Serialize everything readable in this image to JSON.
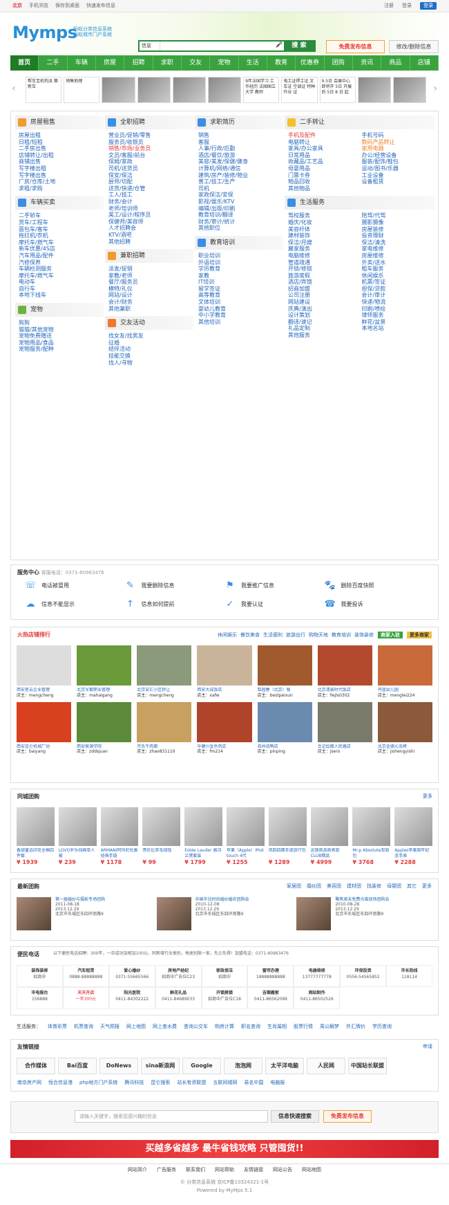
{
  "topbar": {
    "city": "北京",
    "links": [
      "手机浏览",
      "保存到桌面",
      "快速发布信息"
    ],
    "register": "注册",
    "login": "登录",
    "login2": "登录"
  },
  "header": {
    "logo": "Mymps",
    "slogan1": "蚂蚁分类信息系统",
    "slogan2": "蚂蚁城市门户系统",
    "search_select": "信息",
    "search_placeholder": "请输入关键字",
    "search_btn": "搜 索",
    "post_btn": "免费发布信息",
    "edit_btn": "修改/删除信息"
  },
  "nav": [
    "首页",
    "二手",
    "车辆",
    "房屋",
    "招聘",
    "求职",
    "交友",
    "宠物",
    "生活",
    "教育",
    "优惠券",
    "团购",
    "资讯",
    "商品",
    "店铺"
  ],
  "slider": [
    "帮车宝机构派 赛新车",
    "销售助理",
    "9年法国学习 工作经历 法国国立大学 教师",
    "电工证焊工证 叉车证 空调证 特种作业 证",
    "9.5日 会展中心即将开 5日 开展后 5日 8 日 起"
  ],
  "cats": {
    "house": {
      "title": "房屋租售",
      "items": [
        "房屋出租",
        "日租/短租",
        "二手房出售",
        "店铺转让/出租",
        "商铺出售",
        "写字楼出租",
        "写字楼出售",
        "厂房/仓库/土地",
        "求租/求购"
      ]
    },
    "car": {
      "title": "车辆买卖",
      "items": [
        "二手轿车",
        "货车/工程车",
        "面包车/客车",
        "拖拉机/农机",
        "摩托车/燃气车",
        "新车优惠/4S店",
        "汽车用品/配件",
        "汽修保养",
        "车辆检测服务",
        "摩托车/燃气车",
        "电动车",
        "自行车",
        "本地下线车"
      ]
    },
    "pet": {
      "title": "宠物",
      "items": [
        "狗狗",
        "猫猫/其他宠物",
        "宠物免费赠送",
        "宠物用品/食品",
        "宠物服务/配种"
      ]
    },
    "fulljob": {
      "title": "全职招聘",
      "items": [
        "营业员/促销/零售",
        "服务员/收银员",
        "销售/市场/业务员",
        "文员/客服/前台",
        "保姆/家政",
        "司机/送货员",
        "保安/保洁",
        "厨师/切配",
        "送货/快递/仓管",
        "工人/技工",
        "财务/会计",
        "老师/培训师",
        "美工/设计/程序员",
        "保健师/美容师",
        "人才招聘会",
        "KTV/酒吧",
        "其他招聘"
      ]
    },
    "parttime": {
      "title": "兼职招聘",
      "items": [
        "派发/促销",
        "家教/老师",
        "餐厅/服务员",
        "模特/礼仪",
        "网站/设计",
        "会计/财务",
        "其他兼职"
      ]
    },
    "dating": {
      "title": "交友活动",
      "items": [
        "找女友/找男友",
        "征婚",
        "结伴活动",
        "技能交换",
        "找人/寻物"
      ]
    },
    "resume": {
      "title": "求职简历",
      "items": [
        "销售",
        "客服",
        "人事/行政/后勤",
        "酒店/餐饮/旅游",
        "美容/美发/保健/健身",
        "计算机/网络/通信",
        "建筑/房产/装修/物业",
        "普工/技工/生产",
        "司机",
        "家政保洁/安保",
        "影视/娱乐/KTV",
        "编辑/出版/印刷",
        "教育培训/翻译",
        "财务/审计/统计",
        "其他职位"
      ]
    },
    "edu": {
      "title": "教育培训",
      "items": [
        "职业培训",
        "外语培训",
        "学历教育",
        "家教",
        "IT培训",
        "留学签证",
        "高等教育",
        "文体培训",
        "婴幼儿教育",
        "中小学教育",
        "其他培训"
      ]
    },
    "second": {
      "title": "二手转让",
      "items": [
        "手机及配件",
        "手机号码",
        "电脑转让",
        "数码产品转让",
        "家具/办公家具",
        "家用电器",
        "日常用品",
        "办公/经营设备",
        "收藏品/工艺品",
        "服装/配饰/鞋包",
        "母婴用品",
        "运动/图书/乐器",
        "门票卡券",
        "工业设备",
        "物品回收",
        "设备租赁",
        "其他物品"
      ]
    },
    "life": {
      "title": "生活服务",
      "items": [
        "驾校服务",
        "陪驾/代驾",
        "婚庆/化妆",
        "摄影摄像",
        "美容纤体",
        "房屋装修",
        "建材装饰",
        "投资理财",
        "保洁/月嫂",
        "保洁/清洗",
        "搬家服务",
        "家电维修",
        "电脑维修",
        "房屋维修",
        "管道疏通",
        "外卖/送水",
        "开锁/修锁",
        "租车服务",
        "旅游度假",
        "休闲娱乐",
        "酒店/宾馆",
        "机票/签证",
        "招商加盟",
        "担保/贷款",
        "公司注册",
        "会计/审计",
        "网站建设",
        "快递/物流",
        "庆典/演出",
        "印刷/喷绘",
        "设计策划",
        "律师服务",
        "翻译/速记",
        "鲜花/盆景",
        "礼品定制",
        "本地名站",
        "其他服务"
      ]
    }
  },
  "service": {
    "title": "服务中心",
    "phone": "客服电话：0371-60963476",
    "items": [
      "电话被冒用",
      "我要删除信息",
      "我要推广信息",
      "删除百度快照",
      "信息不能显示",
      "信息如何提前",
      "我要认证",
      "我要投诉"
    ]
  },
  "shops": {
    "title": "火热店铺排行",
    "tabs": [
      "休闲娱乐",
      "餐饮美食",
      "生活便利",
      "旅游出行",
      "购物天地",
      "教育培训",
      "装饰装修"
    ],
    "btn1": "商家入驻",
    "btn2": "更多商家",
    "list": [
      [
        "西安星云企业管理",
        "店主：mengcheng"
      ],
      [
        "北京军都职业管理",
        "店主：mahaigang"
      ],
      [
        "北京安汇小区转让",
        "店主：mengcheng"
      ],
      [
        "西安大成饭店",
        "店主：xafw"
      ],
      [
        "梨园春（北京）餐",
        "店主：bestpeixun"
      ],
      [
        "北京清晨时代饭店",
        "店主：fwjls0302"
      ],
      [
        "丹蓝幼儿园",
        "店主：menglei224"
      ],
      [
        "西安昆仑机械厂动",
        "店主：baiyang"
      ],
      [
        "西安索源学院",
        "店主：zddsjuan"
      ],
      [
        "齐氏牛肉面",
        "店主：zhao831110"
      ],
      [
        "华健川金杀鸡店",
        "店主：fm214"
      ],
      [
        "郑州烧鸭店",
        "店主：pinping"
      ],
      [
        "合记烩面人民路店",
        "店主：jsero"
      ],
      [
        "北京金德沁流烤",
        "店主：jishengyishi"
      ]
    ]
  },
  "tuan": {
    "title": "同城团购",
    "more": "更多",
    "list": [
      [
        "香甜童话印花全棉四件套",
        "¥ 1939"
      ],
      [
        "LOVO罗乐纯棉单人被",
        "¥ 239"
      ],
      [
        "ARMANI阿玛尼优雅经典手链",
        "¥ 1178"
      ],
      [
        "哥伦比亚毛绒毯",
        "¥ 99"
      ],
      [
        "Estée Lauder 雅诗兰黛套装",
        "¥ 1799"
      ],
      [
        "苹果（Apple）iPod touch 4代",
        "¥ 1255"
      ],
      [
        "风韵四面手提旅行包",
        "¥ 1289"
      ],
      [
        "运营商品质男款CLUB精品",
        "¥ 4999"
      ],
      [
        "Mr.p Absolute双肩包",
        "¥ 3768"
      ],
      [
        "Apples苹果周年纪念手表",
        "¥ 2288"
      ]
    ]
  },
  "latest": {
    "title": "最新团购",
    "tabs": [
      "家居团",
      "婚纱团",
      "美容团",
      "建材团",
      "找装修",
      "母婴团",
      "其它",
      "更多"
    ],
    "list": [
      [
        "第一届婚纱与摄影专场团购",
        "2011-08-18",
        "2013.12.29",
        "北京市东城区东四环南路9"
      ],
      [
        "中国华北时尚婚纱婚庆团购会",
        "2010-12-08",
        "2013.12.29",
        "北京市东城区东四环南路9"
      ],
      [
        "聚焦周末免费光临现场团购会",
        "2010-08-28",
        "2013.12.29",
        "北京市东城区东四环南路9"
      ]
    ]
  },
  "phones": {
    "title": "便民电话",
    "note": "以下便民电话招聘：300年，一旦成功加相加100元，同新增行业类别，每类别限一家，先占先得！加盟电话：0371-60963476",
    "list": [
      [
        "装饰装修",
        "招商中"
      ],
      [
        "汽车租赁",
        "0888-88888888"
      ],
      [
        "爱心婚纱",
        "0371-55665566"
      ],
      [
        "房地产经纪",
        "招商中广告位C23"
      ],
      [
        "家政保洁",
        "招商中"
      ],
      [
        "窗帘办理",
        "18888888888"
      ],
      [
        "电器维修",
        "13777777778"
      ],
      [
        "环保投资",
        "0556-54565852"
      ],
      [
        "市长热线",
        "118114"
      ],
      [
        "市电报台",
        "156888"
      ],
      [
        "天天开店",
        "一年300元"
      ],
      [
        "阳光医院",
        "0411-84302222"
      ],
      [
        "鲜花礼品",
        "0411-84689033"
      ],
      [
        "开锁换锁",
        "招商中广告位C18"
      ],
      [
        "吉顺搬家",
        "0411-86562099"
      ],
      [
        "网站制作",
        "0411-86502526"
      ]
    ]
  },
  "mainlinks": {
    "title": "生活服务：",
    "items": [
      "体育彩票",
      "机票查询",
      "天气预报",
      "网上地图",
      "网上查水费",
      "查询公交车",
      "购房计算",
      "职名查询",
      "生肖属相",
      "股票行情",
      "周公解梦",
      "外汇牌价",
      "学历查询"
    ]
  },
  "friend": {
    "title": "友情链接",
    "apply": "申请",
    "logos": [
      "合作媒体",
      "Bai百度",
      "DoNews",
      "sina新浪网",
      "Google",
      "泡泡网",
      "太平洋电脑",
      "人民网",
      "中国站长联盟"
    ],
    "text": [
      "南京房产网",
      "恒合信息港",
      "php地方门户系统",
      "腾讯科技",
      "昆仑搜索",
      "站长有资联盟",
      "五联同城网",
      "易名中国",
      "电脑报"
    ]
  },
  "bottomsearch": {
    "placeholder": "请输入关键字，搜索您感兴趣的信息",
    "btn1": "信息快速搜索",
    "btn2": "免费发布信息"
  },
  "banner": "买越多省越多 最牛省钱攻略 只管囤货!!",
  "footer": {
    "links": [
      "网站简介",
      "广告服务",
      "联系我们",
      "网站帮助",
      "友情链接",
      "网站公告",
      "网站地图"
    ],
    "copy": "© 分类信息系统   京ICP备10324321-1号",
    "powered": "Powered by MyMps 5.1"
  }
}
